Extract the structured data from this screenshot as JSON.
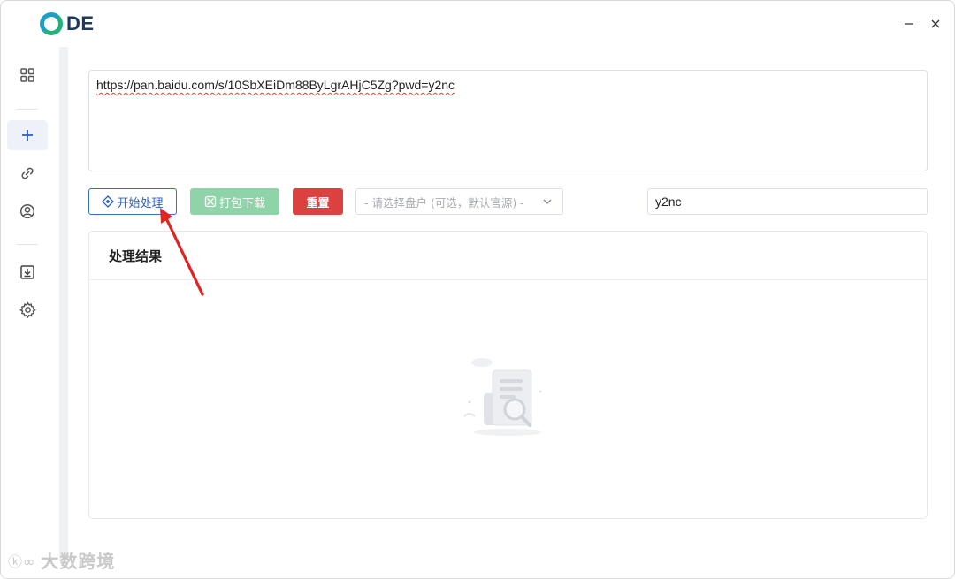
{
  "app": {
    "logo_text": "DE"
  },
  "window_controls": {
    "minimize": "—",
    "close": "✕"
  },
  "sidebar": {
    "items": [
      {
        "name": "dashboard",
        "icon": "grid-icon"
      },
      {
        "name": "add",
        "icon": "plus-icon",
        "active": true
      },
      {
        "name": "links",
        "icon": "link-icon"
      },
      {
        "name": "account",
        "icon": "user-circle-icon"
      },
      {
        "name": "downloads",
        "icon": "download-box-icon"
      },
      {
        "name": "settings",
        "icon": "gear-icon"
      }
    ]
  },
  "url_input": {
    "value": "https://pan.baidu.com/s/10SbXEiDm88ByLgrAHjC5Zg?pwd=y2nc"
  },
  "toolbar": {
    "start_label": "开始处理",
    "pack_label": "打包下载",
    "reset_label": "重置",
    "disk_select_placeholder": "- 请选择盘户 (可选，默认官源) -",
    "password_value": "y2nc"
  },
  "result": {
    "title": "处理结果"
  },
  "watermark": {
    "text": "大数跨境",
    "logo": "ⓚ∞"
  },
  "colors": {
    "accent_blue": "#2c5fbf",
    "pack_green": "#8fd3a9",
    "reset_red": "#dc4140",
    "annotation_arrow": "#e02424"
  }
}
